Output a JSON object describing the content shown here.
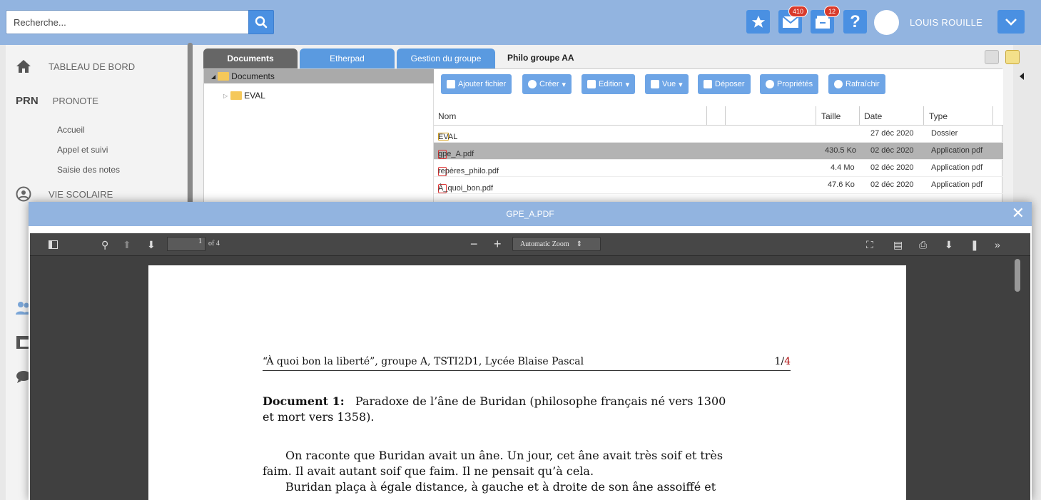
{
  "header": {
    "search_placeholder": "Recherche...",
    "mail_badge": "410",
    "inbox_badge": "12",
    "username": "LOUIS ROUILLE"
  },
  "sidebar": {
    "dashboard": "TABLEAU DE BORD",
    "pronote_logo": "PRN",
    "pronote": "PRONOTE",
    "sub_items": [
      "Accueil",
      "Appel et suivi",
      "Saisie des notes"
    ],
    "vie_scolaire": "VIE SCOLAIRE"
  },
  "tabs": {
    "documents": "Documents",
    "etherpad": "Etherpad",
    "gestion": "Gestion du groupe",
    "group_title": "Philo groupe AA"
  },
  "tree": {
    "root": "Documents",
    "child": "EVAL"
  },
  "toolbar": {
    "add_file": "Ajouter fichier",
    "create": "Créer",
    "edition": "Edition",
    "view": "Vue",
    "deposit": "Déposer",
    "properties": "Propriétés",
    "refresh": "Rafraîchir"
  },
  "table": {
    "headers": [
      "Nom",
      "Taille",
      "Date",
      "Type"
    ],
    "rows": [
      {
        "name": "EVAL",
        "size": "",
        "date": "27 déc 2020",
        "type": "Dossier"
      },
      {
        "name": "gpe_A.pdf",
        "size": "430.5 Ko",
        "date": "02 déc 2020",
        "type": "Application pdf"
      },
      {
        "name": "repères_philo.pdf",
        "size": "4.4 Mo",
        "date": "02 déc 2020",
        "type": "Application pdf"
      },
      {
        "name": "À_quoi_bon.pdf",
        "size": "47.6 Ko",
        "date": "02 déc 2020",
        "type": "Application pdf"
      }
    ]
  },
  "modal": {
    "title": "GPE_A.PDF",
    "page_number": "1",
    "page_of": "of 4",
    "zoom": "Automatic Zoom"
  },
  "doc": {
    "header_text": "“À quoi bon la liberté”, groupe A, TSTI2D1, Lycée Blaise Pascal",
    "page_current": "1/",
    "page_total": "4",
    "doc_label": "Document 1:",
    "line1": "Paradoxe de l’âne de Buridan (philosophe français né vers 1300",
    "line2": "et mort vers 1358).",
    "line3": "On raconte que Buridan avait un âne. Un jour, cet âne avait très soif et très",
    "line4": "faim. Il avait autant soif que faim. Il ne pensait qu’à cela.",
    "line5": "Buridan plaça à égale distance, à gauche et à droite de son âne assoiffé et"
  }
}
